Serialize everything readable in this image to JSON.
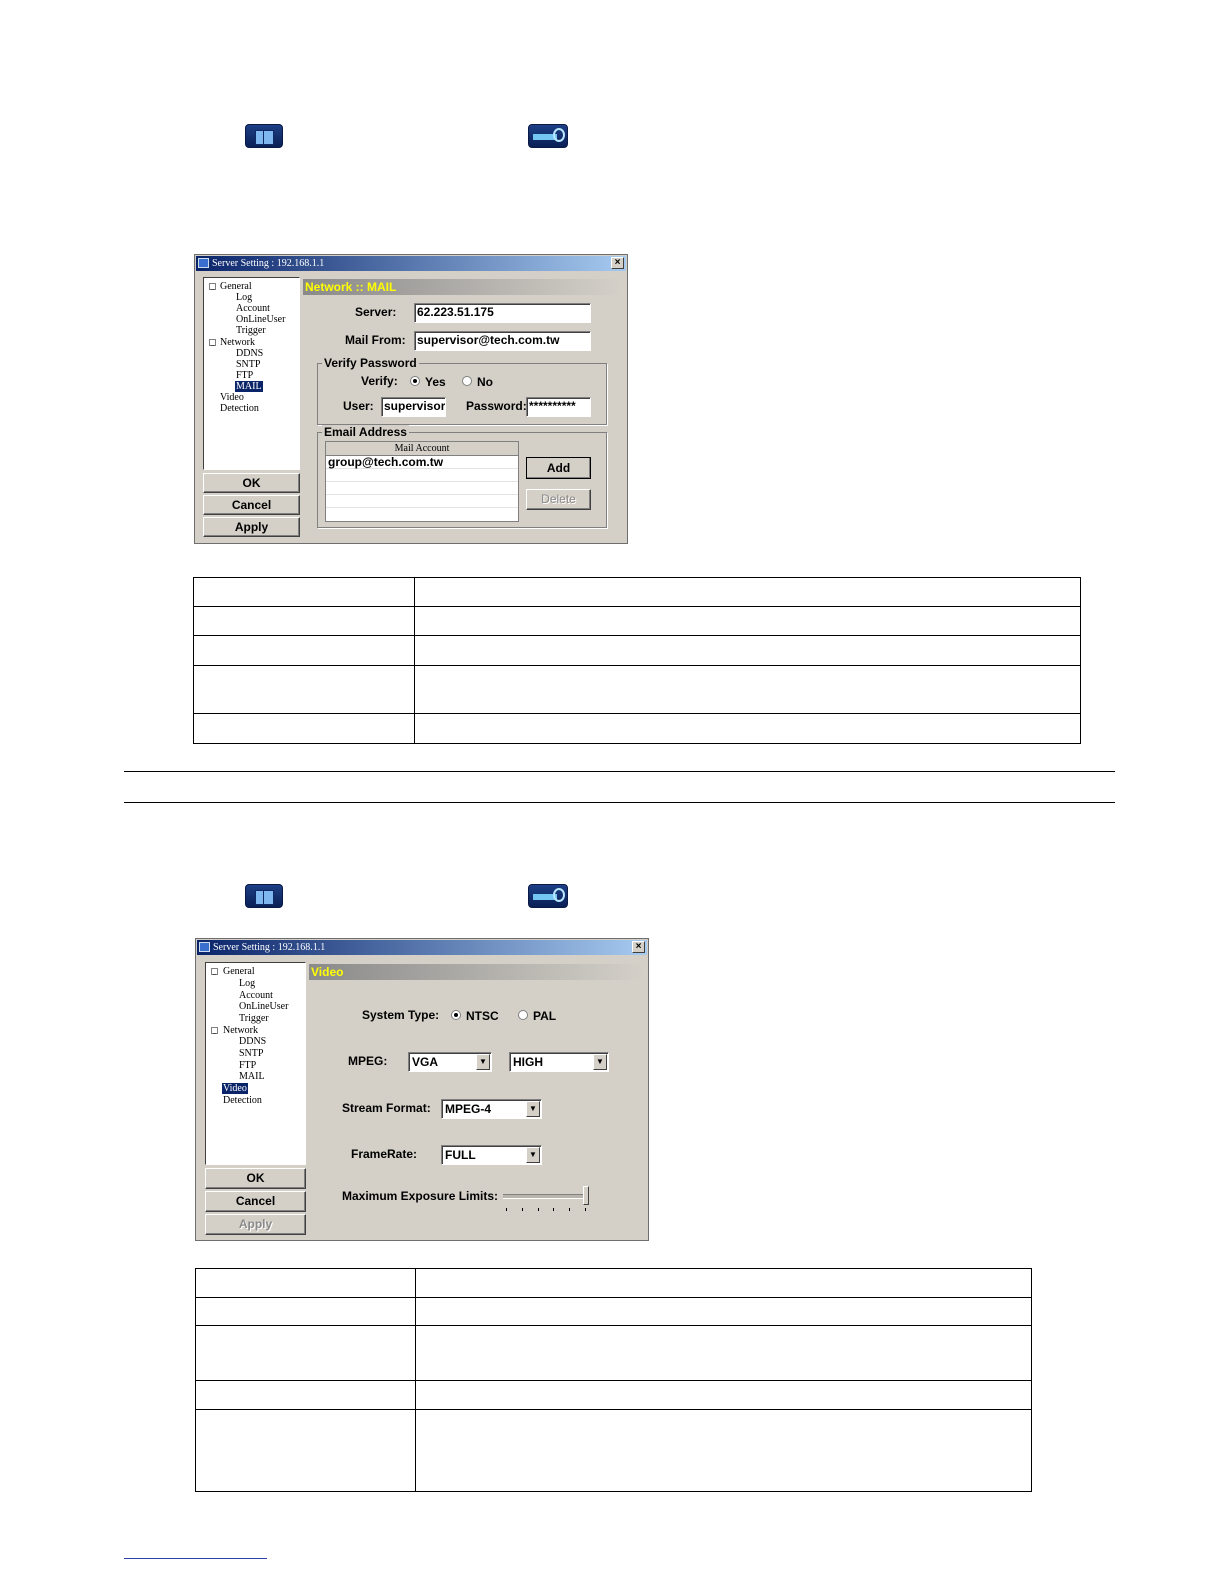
{
  "section_mail": {
    "toolbar_icons": [
      "setup-icon",
      "network-icon"
    ],
    "dialog": {
      "title": "Server Setting : 192.168.1.1",
      "close_glyph": "×",
      "tree": [
        "General",
        "Log",
        "Account",
        "OnLineUser",
        "Trigger",
        "Network",
        "DDNS",
        "SNTP",
        "FTP",
        "MAIL",
        "Video",
        "Detection"
      ],
      "selected": "MAIL",
      "buttons": {
        "ok": "OK",
        "cancel": "Cancel",
        "apply": "Apply"
      },
      "panel_title": "Network :: MAIL",
      "server_label": "Server:",
      "server_value": "62.223.51.175",
      "mail_from_label": "Mail From:",
      "mail_from_value": "supervisor@tech.com.tw",
      "verify_group": "Verify Password",
      "verify_label": "Verify:",
      "verify_yes": "Yes",
      "verify_no": "No",
      "verify_selected": "Yes",
      "user_label": "User:",
      "user_value": "supervisor",
      "password_label": "Password:",
      "password_value": "**********",
      "email_group": "Email Address",
      "list_header": "Mail Account",
      "accounts": [
        "group@tech.com.tw"
      ],
      "add_button": "Add",
      "delete_button": "Delete"
    }
  },
  "section_video": {
    "toolbar_icons": [
      "setup-icon",
      "network-icon"
    ],
    "dialog": {
      "title": "Server Setting : 192.168.1.1",
      "close_glyph": "×",
      "tree": [
        "General",
        "Log",
        "Account",
        "OnLineUser",
        "Trigger",
        "Network",
        "DDNS",
        "SNTP",
        "FTP",
        "MAIL",
        "Video",
        "Detection"
      ],
      "selected": "Video",
      "buttons": {
        "ok": "OK",
        "cancel": "Cancel",
        "apply": "Apply"
      },
      "panel_title": "Video",
      "system_type_label": "System Type:",
      "ntsc": "NTSC",
      "pal": "PAL",
      "system_selected": "NTSC",
      "mpeg_label": "MPEG:",
      "mpeg_resolution": "VGA",
      "mpeg_quality": "HIGH",
      "stream_format_label": "Stream Format:",
      "stream_format": "MPEG-4",
      "framerate_label": "FrameRate:",
      "framerate": "FULL",
      "exposure_label": "Maximum Exposure Limits:",
      "exposure_level": 1.0
    }
  }
}
